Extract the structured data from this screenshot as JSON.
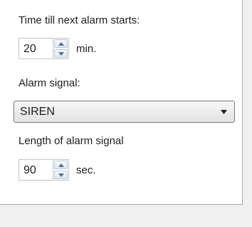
{
  "alarm_delay": {
    "label": "Time till next alarm starts:",
    "value": "20",
    "unit": "min."
  },
  "signal": {
    "label": "Alarm signal:",
    "selected": "SIREN"
  },
  "signal_length": {
    "label": "Length of alarm signal",
    "value": "90",
    "unit": "sec."
  },
  "icons": {
    "spin_up": "chevron-up-icon",
    "spin_down": "chevron-down-icon",
    "dropdown": "caret-down-icon"
  },
  "colors": {
    "panel_bg": "#ffffff",
    "window_bg": "#f0f0f0",
    "spin_arrow": "#4a6f94"
  }
}
